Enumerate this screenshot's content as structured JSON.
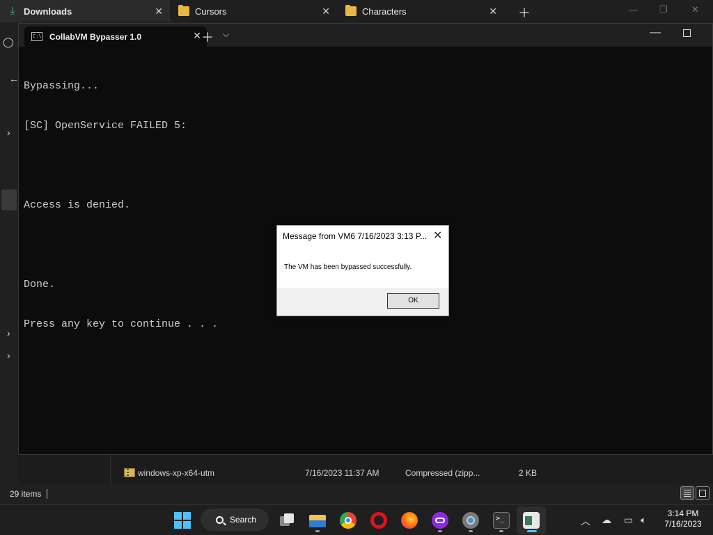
{
  "explorer": {
    "tabs": [
      {
        "label": "Downloads",
        "icon": "download-icon",
        "active": true
      },
      {
        "label": "Cursors",
        "icon": "folder-icon",
        "active": false
      },
      {
        "label": "Characters",
        "icon": "folder-icon",
        "active": false
      }
    ],
    "file": {
      "name": "windows-xp-x64-utm",
      "date": "7/16/2023 11:37 AM",
      "type": "Compressed (zipp...",
      "size": "2 KB"
    },
    "status": {
      "count": "29 items"
    }
  },
  "terminal": {
    "tab_title": "CollabVM Bypasser 1.0",
    "lines": [
      "Bypassing...",
      "[SC] OpenService FAILED 5:",
      "",
      "Access is denied.",
      "",
      "Done.",
      "Press any key to continue . . ."
    ],
    "text_color": "#cccccc",
    "background": "#0c0c0c"
  },
  "dialog": {
    "title": "Message from VM6 7/16/2023 3:13 P...",
    "message": "The VM has been bypassed successfully.",
    "ok_label": "OK"
  },
  "taskbar": {
    "search_label": "Search",
    "apps": [
      "start-icon",
      "task-view-icon",
      "file-explorer-icon",
      "chrome-icon",
      "opera-icon",
      "firefox-icon",
      "app-icon",
      "settings-icon",
      "terminal-icon",
      "active-app-icon"
    ],
    "clock": {
      "time": "3:14 PM",
      "date": "7/16/2023"
    },
    "accent": "#4cc2ff"
  }
}
